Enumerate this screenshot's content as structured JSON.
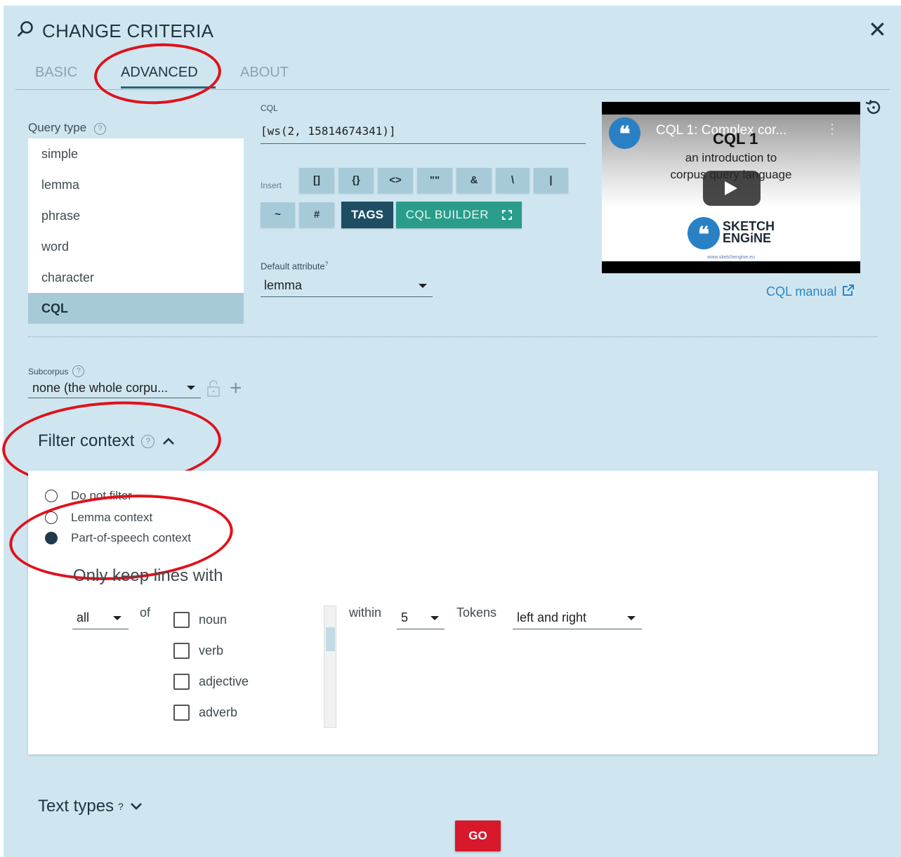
{
  "header": {
    "title": "CHANGE CRITERIA",
    "close_label": "✕"
  },
  "tabs": [
    {
      "label": "BASIC",
      "active": false
    },
    {
      "label": "ADVANCED",
      "active": true
    },
    {
      "label": "ABOUT",
      "active": false
    }
  ],
  "query_type": {
    "label": "Query type",
    "items": [
      "simple",
      "lemma",
      "phrase",
      "word",
      "character",
      "CQL"
    ],
    "selected": "CQL"
  },
  "cql": {
    "label": "CQL",
    "value": "[ws(2, 15814674341)]",
    "insert_label": "Insert",
    "insert_buttons": [
      "[]",
      "{}",
      "<>",
      "\"\"",
      "&",
      "\\",
      "|",
      "~",
      "#"
    ],
    "tags_label": "TAGS",
    "builder_label": "CQL BUILDER"
  },
  "default_attribute": {
    "label": "Default attribute",
    "sup": "?",
    "value": "lemma"
  },
  "video": {
    "title": "CQL 1: Complex cor...",
    "slide_title": "CQL 1",
    "slide_line1": "an introduction to",
    "slide_line2": "corpus query language",
    "logo_line1": "SKETCH",
    "logo_line2": "ENGiNE",
    "logo_url": "www.sketchengine.eu"
  },
  "cql_manual": "CQL manual",
  "subcorpus": {
    "label": "Subcorpus",
    "value": "none (the whole corpu..."
  },
  "filter_context": {
    "heading": "Filter context",
    "options": [
      {
        "label": "Do not filter",
        "selected": false
      },
      {
        "label": "Lemma context",
        "selected": false
      },
      {
        "label": "Part-of-speech context",
        "selected": true
      }
    ],
    "keep_label": "Only keep lines with",
    "quantifier": "all",
    "of_label": "of",
    "pos_items": [
      "noun",
      "verb",
      "adjective",
      "adverb"
    ],
    "within_label": "within",
    "within_value": "5",
    "tokens_label": "Tokens",
    "direction": "left and right"
  },
  "text_types": {
    "heading": "Text types",
    "sup": "?"
  },
  "go_label": "GO",
  "colors": {
    "panel": "#cfe6f0",
    "accent": "#1e4d64",
    "builder": "#2a9d8a",
    "go": "#d7192b",
    "highlight": "#e0111b"
  }
}
